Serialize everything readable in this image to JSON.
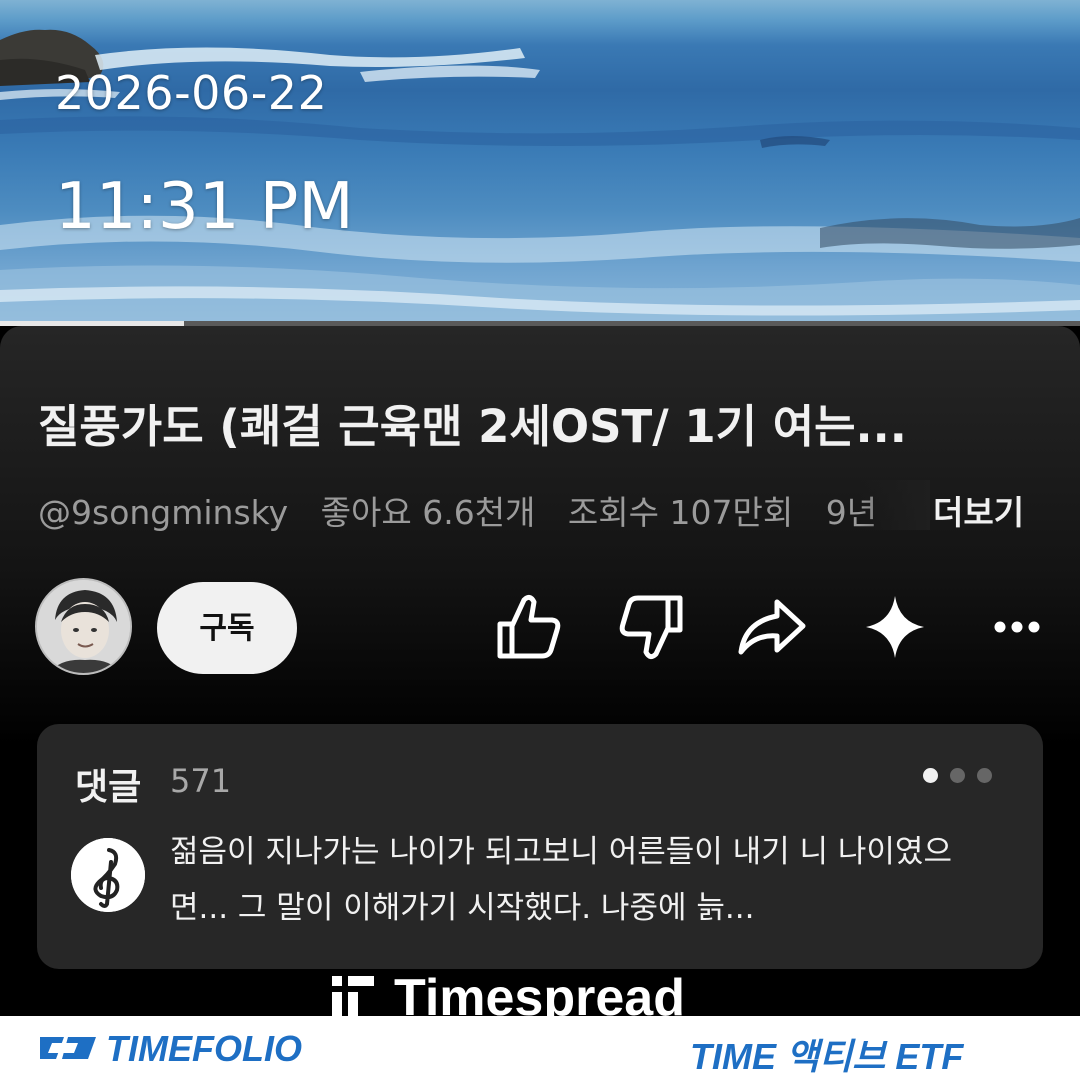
{
  "overlay": {
    "date": "2026-06-22",
    "time": "11:31 PM"
  },
  "player": {
    "progress_fraction": 0.17
  },
  "video": {
    "title": "질풍가도 (쾌걸 근육맨 2세OST/ 1기 여는...",
    "channel": "@9songminsky",
    "likes": "좋아요 6.6천개",
    "views": "조회수 107만회",
    "age_partial": "9년",
    "more_label": "더보기"
  },
  "actions": {
    "subscribe_label": "구독",
    "icons": [
      "thumbs-up-icon",
      "thumbs-down-icon",
      "share-icon",
      "sparkle-icon",
      "more-options-icon"
    ]
  },
  "comments": {
    "label": "댓글",
    "count": "571",
    "top_comment": "젊음이 지나가는 나이가 되고보니 어른들이 내기 니 나이였으면... 그 말이 이해가기 시작했다. 나중에 늙...",
    "pager": {
      "total": 3,
      "active": 0
    }
  },
  "watermark": {
    "text": "Timespread"
  },
  "banner": {
    "left": "TIMEFOLIO",
    "right": "TIME 액티브 ETF"
  },
  "colors": {
    "brand_blue": "#1e6fc4",
    "card_bg": "#272727",
    "panel_bg": "#0f0f0f"
  }
}
